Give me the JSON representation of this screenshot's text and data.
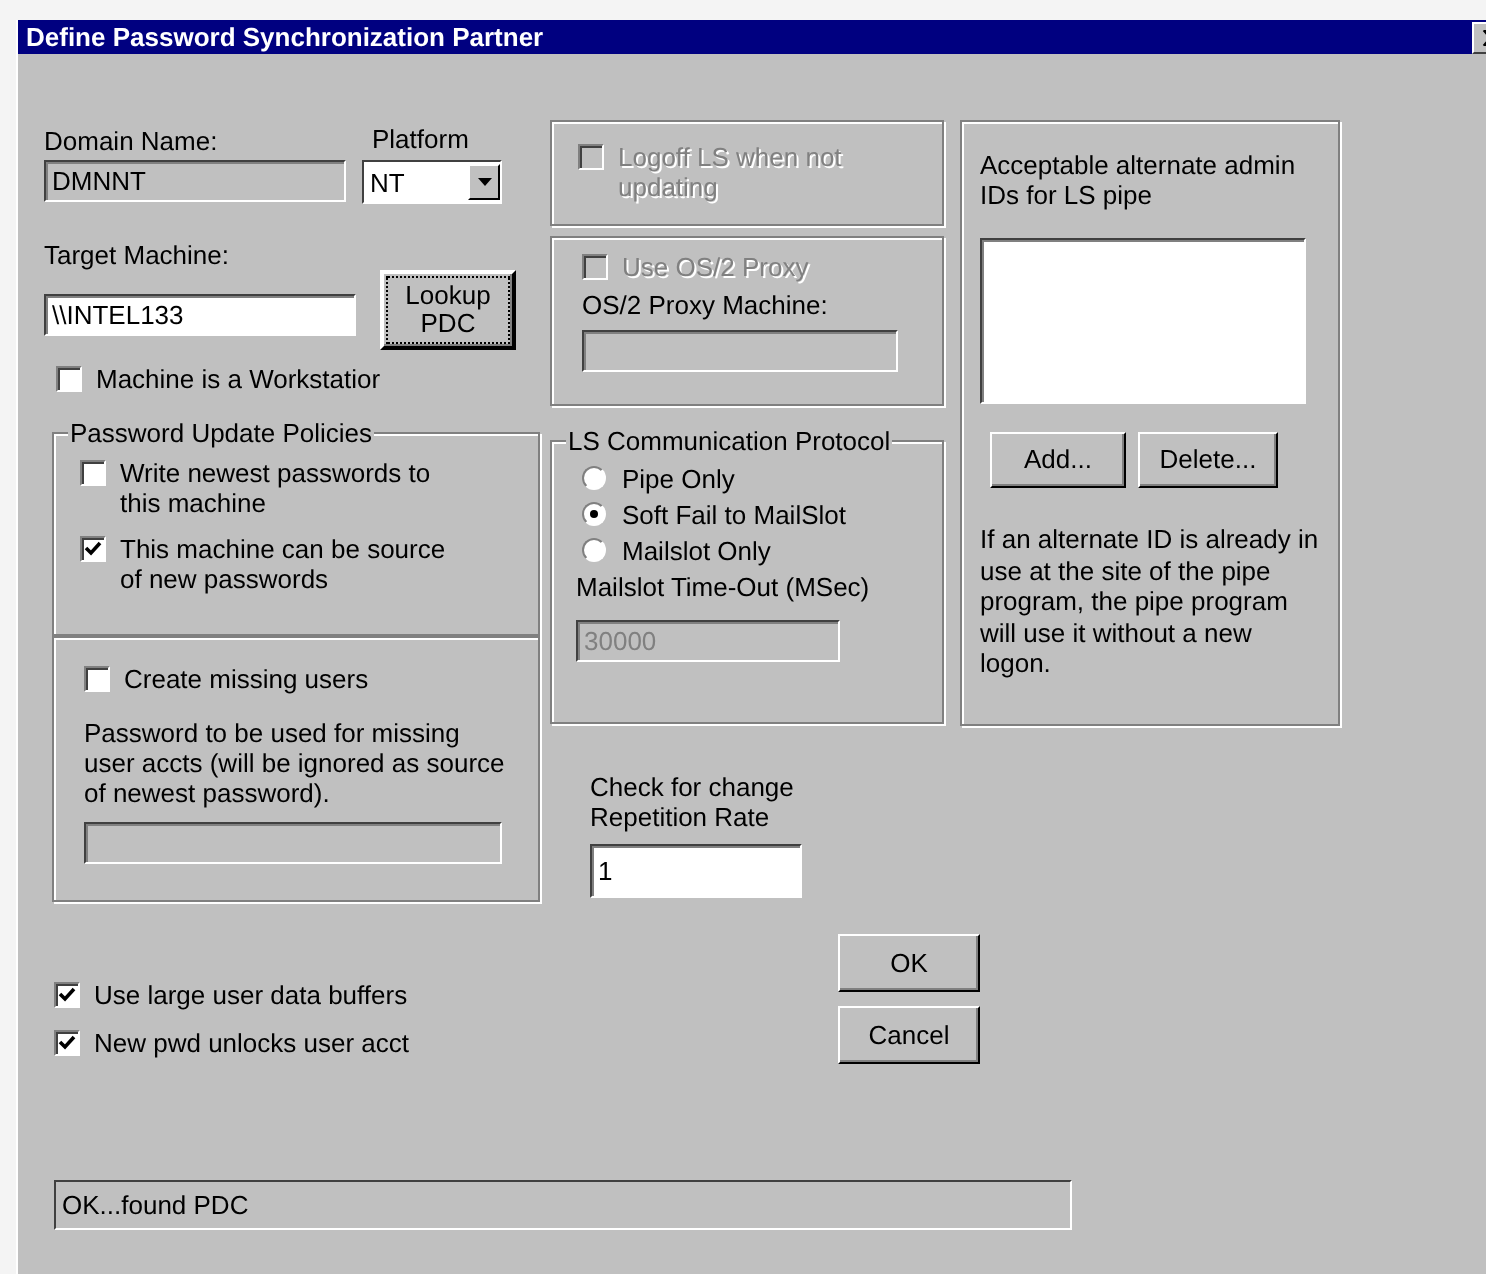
{
  "window": {
    "title": "Define Password Synchronization Partner"
  },
  "domain": {
    "label": "Domain Name:",
    "value": "DMNNT",
    "disabled": true
  },
  "platform": {
    "label": "Platform",
    "value": "NT"
  },
  "target": {
    "label": "Target Machine:",
    "value": "\\\\INTEL133"
  },
  "lookup_button": {
    "label": "Lookup PDC"
  },
  "workstation": {
    "label": "Machine is a Workstatior",
    "checked": false
  },
  "update_policies": {
    "title": "Password Update Policies",
    "options": [
      {
        "label": "Write newest passwords to this machine",
        "checked": false
      },
      {
        "label": "This machine can be source of new passwords",
        "checked": true
      }
    ]
  },
  "missing_users": {
    "label": "Create missing users",
    "checked": false,
    "note": "Password to be used for missing user accts (will be ignored as source of newest password).",
    "field_disabled": true
  },
  "logoff": {
    "label": "Logoff LS when not updating",
    "checked": false,
    "disabled": true
  },
  "os2_proxy": {
    "label": "Use OS/2 Proxy",
    "checked": false,
    "disabled": true,
    "machine_label": "OS/2 Proxy Machine:",
    "field_disabled": true
  },
  "protocol": {
    "title": "LS Communication Protocol",
    "options": [
      {
        "label": "Pipe Only",
        "selected": false
      },
      {
        "label": "Soft Fail to MailSlot",
        "selected": true
      },
      {
        "label": "Mailslot Only",
        "selected": false
      }
    ],
    "timeout_label": "Mailslot Time-Out (MSec)",
    "timeout_value": "30000",
    "timeout_disabled": true
  },
  "repetition": {
    "label": "Check for change Repetition Rate",
    "value": "1"
  },
  "alternate_ids": {
    "label": "Acceptable alternate admin IDs for LS pipe",
    "buttons": [
      "Add...",
      "Delete..."
    ],
    "note": "If an alternate ID is already in use at the site of the pipe program, the pipe program will use it without a new logon."
  },
  "options": [
    {
      "label": "Use large user data buffers",
      "checked": true
    },
    {
      "label": "New pwd unlocks user acct",
      "checked": true
    }
  ],
  "buttons": [
    "OK",
    "Cancel"
  ],
  "status_bar": "OK...found PDC"
}
